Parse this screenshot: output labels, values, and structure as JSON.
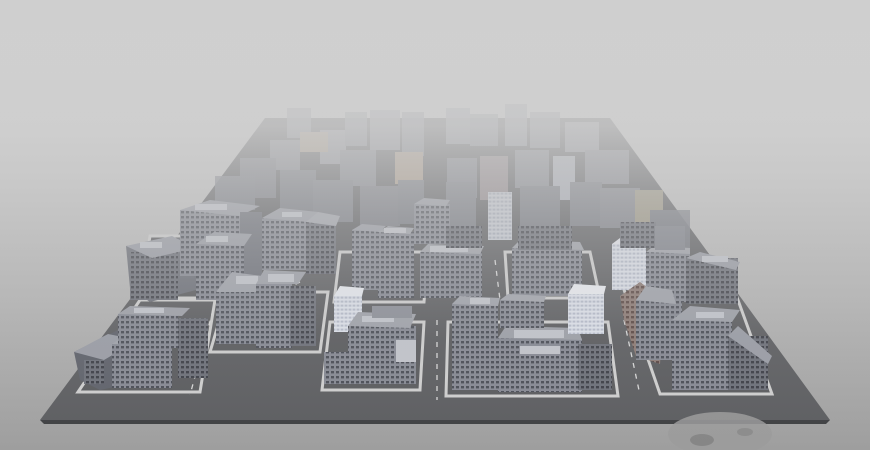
{
  "scene": {
    "subject": "foggy-city-grid",
    "colors": {
      "sky_top": "#d6d6d6",
      "sky_bottom": "#a9a9a9",
      "ground": "#5b5c5e",
      "road": "#4e4f52",
      "sidewalk": "#c9c9c9",
      "building_side": "#6e7078",
      "building_front": "#878a94",
      "roof": "#9a9da6",
      "roof_panel": "#c2c5cc",
      "window": "#3f414a",
      "glass_tower": "#dfe4ee",
      "accent_tan": "#b9a58f",
      "accent_brick": "#8a5a4a",
      "fog": "#cfcfcf"
    }
  }
}
